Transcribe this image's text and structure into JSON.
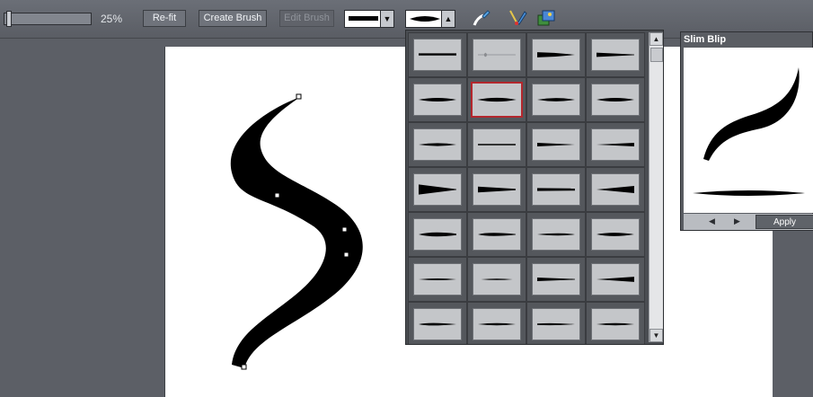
{
  "toolbar": {
    "zoom": "25%",
    "refit_label": "Re-fit",
    "create_brush_label": "Create Brush",
    "edit_brush_label": "Edit Brush"
  },
  "icons": [
    "brush-tool-icon",
    "pen-tool-icon",
    "image-tool-icon"
  ],
  "brush_gallery": {
    "selected_index": 5,
    "rows": 7,
    "columns": 4,
    "brush_count": 28
  },
  "preview_panel": {
    "title": "Slim Blip",
    "prev_label": "◀",
    "next_label": "▶",
    "apply_label": "Apply"
  },
  "colors": {
    "selected_border": "#b3272d",
    "ink": "#000000"
  }
}
